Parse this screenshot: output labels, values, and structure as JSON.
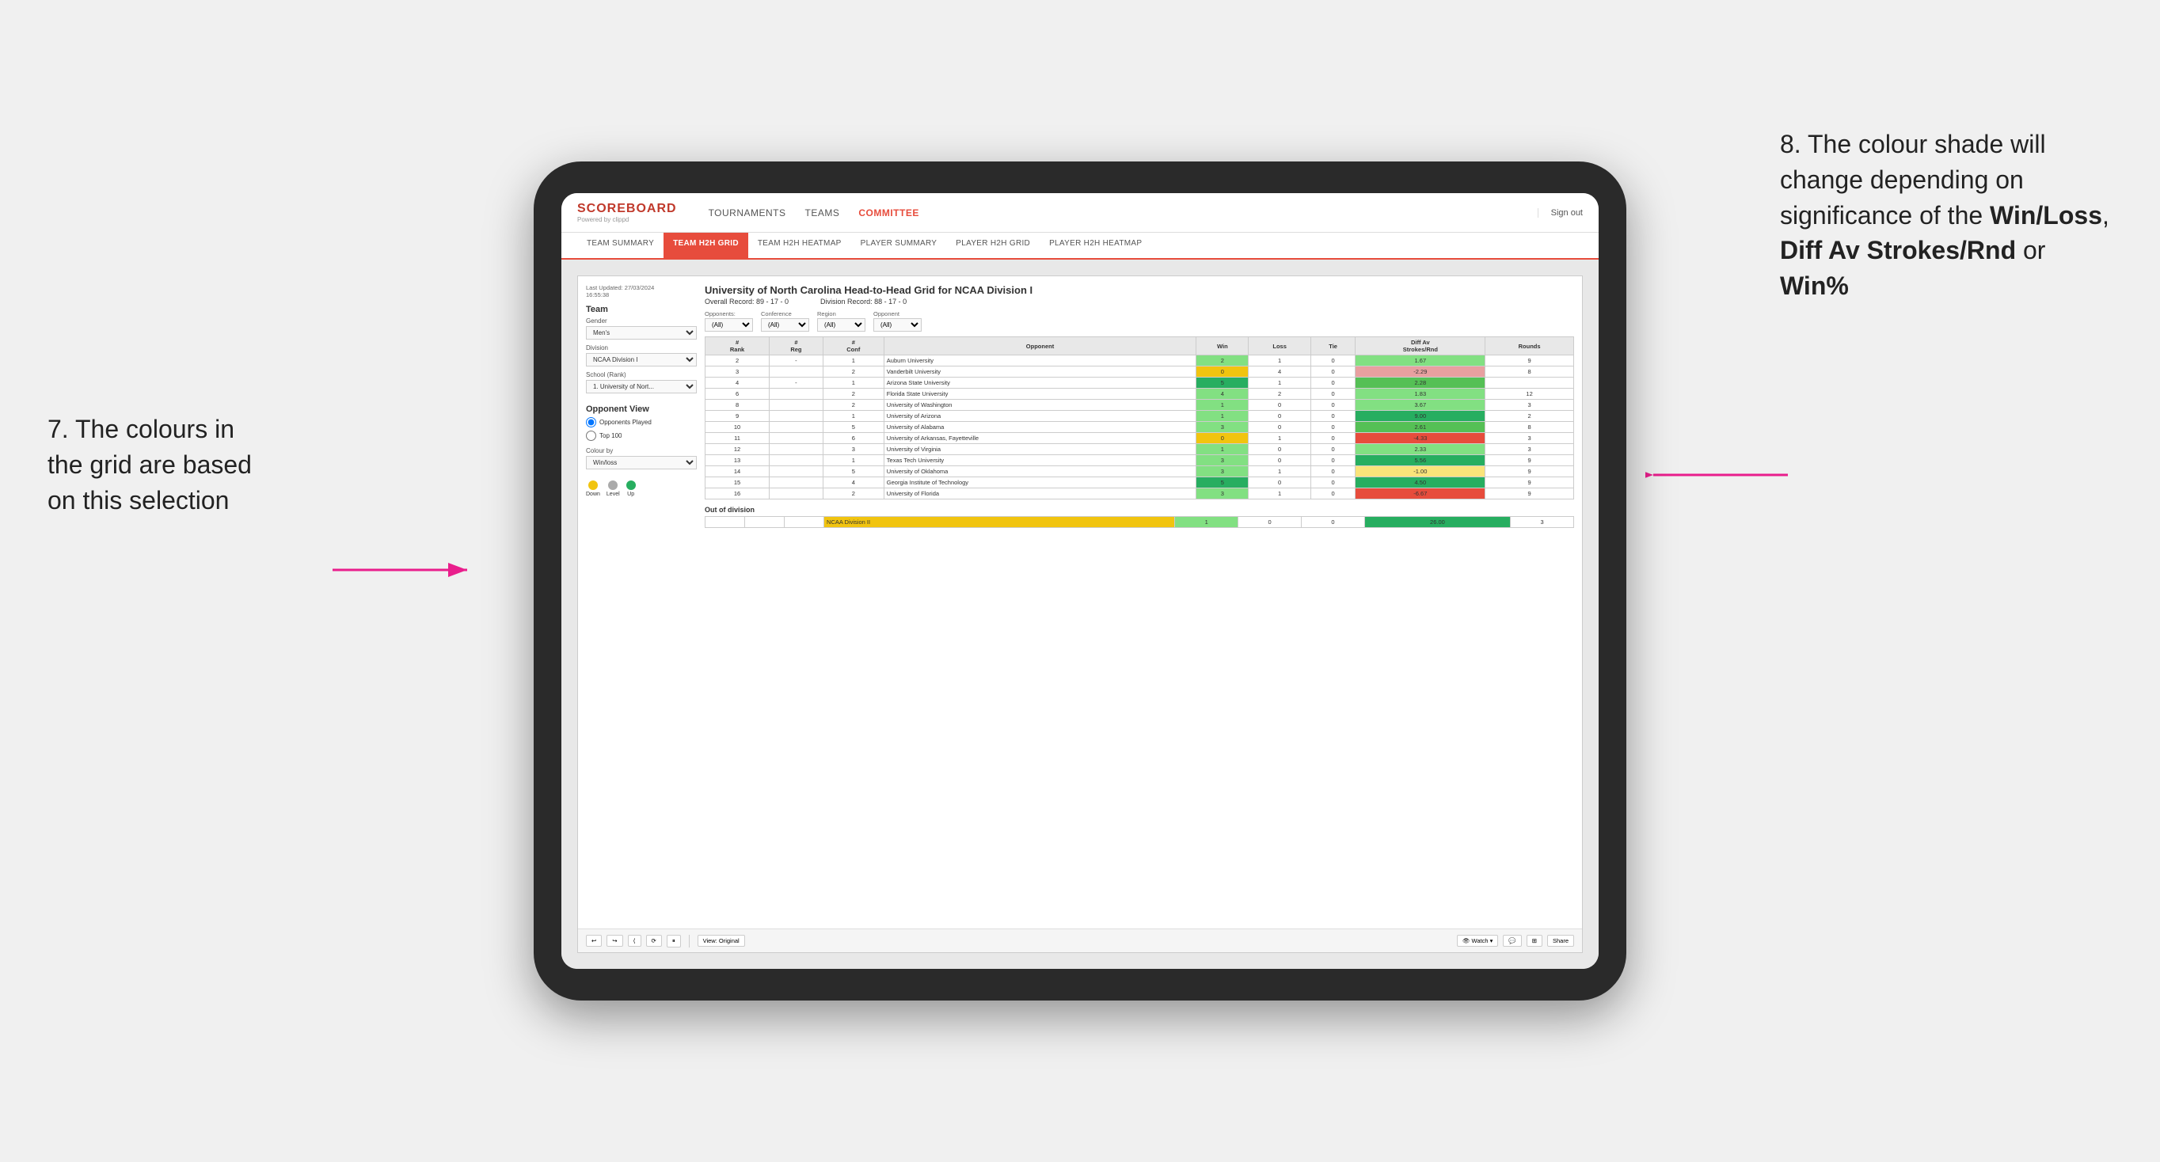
{
  "page": {
    "background": "#f0f0f0"
  },
  "annotation_left": {
    "text": "7. The colours in the grid are based on this selection"
  },
  "annotation_right": {
    "line1": "8. The colour shade will change depending on significance of the ",
    "bold1": "Win/Loss",
    "line2": ", ",
    "bold2": "Diff Av Strokes/Rnd",
    "line3": " or ",
    "bold3": "Win%"
  },
  "header": {
    "logo": "SCOREBOARD",
    "logo_sub": "Powered by clippd",
    "nav": [
      "TOURNAMENTS",
      "TEAMS",
      "COMMITTEE"
    ],
    "active_nav": "COMMITTEE",
    "sign_out": "Sign out"
  },
  "sub_nav": {
    "items": [
      "TEAM SUMMARY",
      "TEAM H2H GRID",
      "TEAM H2H HEATMAP",
      "PLAYER SUMMARY",
      "PLAYER H2H GRID",
      "PLAYER H2H HEATMAP"
    ],
    "active": "TEAM H2H GRID"
  },
  "left_panel": {
    "timestamp_label": "Last Updated: 27/03/2024",
    "timestamp_time": "16:55:38",
    "team_label": "Team",
    "gender_label": "Gender",
    "gender_value": "Men's",
    "division_label": "Division",
    "division_value": "NCAA Division I",
    "school_label": "School (Rank)",
    "school_value": "1. University of Nort...",
    "opponent_view_label": "Opponent View",
    "opponents_played": "Opponents Played",
    "top_100": "Top 100",
    "colour_by_label": "Colour by",
    "colour_by_value": "Win/loss",
    "legend": {
      "down_label": "Down",
      "level_label": "Level",
      "up_label": "Up",
      "down_color": "#f1c40f",
      "level_color": "#aaaaaa",
      "up_color": "#27ae60"
    }
  },
  "grid": {
    "title": "University of North Carolina Head-to-Head Grid for NCAA Division I",
    "overall_record": "Overall Record: 89 - 17 - 0",
    "division_record": "Division Record: 88 - 17 - 0",
    "filters": {
      "opponents_label": "Opponents:",
      "opponents_value": "(All)",
      "conference_label": "Conference",
      "conference_value": "(All)",
      "region_label": "Region",
      "region_value": "(All)",
      "opponent_label": "Opponent",
      "opponent_value": "(All)"
    },
    "columns": [
      "#\nRank",
      "#\nReg",
      "#\nConf",
      "Opponent",
      "Win",
      "Loss",
      "Tie",
      "Diff Av\nStrokes/Rnd",
      "Rounds"
    ],
    "rows": [
      {
        "rank": "2",
        "reg": "-",
        "conf": "1",
        "opponent": "Auburn University",
        "win": "2",
        "loss": "1",
        "tie": "0",
        "diff": "1.67",
        "rounds": "9",
        "win_color": "green-light",
        "diff_color": "green-light"
      },
      {
        "rank": "3",
        "reg": "",
        "conf": "2",
        "opponent": "Vanderbilt University",
        "win": "0",
        "loss": "4",
        "tie": "0",
        "diff": "-2.29",
        "rounds": "8",
        "win_color": "yellow",
        "diff_color": "red-light"
      },
      {
        "rank": "4",
        "reg": "-",
        "conf": "1",
        "opponent": "Arizona State University",
        "win": "5",
        "loss": "1",
        "tie": "0",
        "diff": "2.28",
        "rounds": "",
        "win_color": "green-dark",
        "diff_color": "green-mid"
      },
      {
        "rank": "6",
        "reg": "",
        "conf": "2",
        "opponent": "Florida State University",
        "win": "4",
        "loss": "2",
        "tie": "0",
        "diff": "1.83",
        "rounds": "12",
        "win_color": "green-light",
        "diff_color": "green-light"
      },
      {
        "rank": "8",
        "reg": "",
        "conf": "2",
        "opponent": "University of Washington",
        "win": "1",
        "loss": "0",
        "tie": "0",
        "diff": "3.67",
        "rounds": "3",
        "win_color": "green-light",
        "diff_color": "green-light"
      },
      {
        "rank": "9",
        "reg": "",
        "conf": "1",
        "opponent": "University of Arizona",
        "win": "1",
        "loss": "0",
        "tie": "0",
        "diff": "9.00",
        "rounds": "2",
        "win_color": "green-light",
        "diff_color": "green-dark"
      },
      {
        "rank": "10",
        "reg": "",
        "conf": "5",
        "opponent": "University of Alabama",
        "win": "3",
        "loss": "0",
        "tie": "0",
        "diff": "2.61",
        "rounds": "8",
        "win_color": "green-light",
        "diff_color": "green-mid"
      },
      {
        "rank": "11",
        "reg": "",
        "conf": "6",
        "opponent": "University of Arkansas, Fayetteville",
        "win": "0",
        "loss": "1",
        "tie": "0",
        "diff": "-4.33",
        "rounds": "3",
        "win_color": "yellow",
        "diff_color": "red"
      },
      {
        "rank": "12",
        "reg": "",
        "conf": "3",
        "opponent": "University of Virginia",
        "win": "1",
        "loss": "0",
        "tie": "0",
        "diff": "2.33",
        "rounds": "3",
        "win_color": "green-light",
        "diff_color": "green-light"
      },
      {
        "rank": "13",
        "reg": "",
        "conf": "1",
        "opponent": "Texas Tech University",
        "win": "3",
        "loss": "0",
        "tie": "0",
        "diff": "5.56",
        "rounds": "9",
        "win_color": "green-light",
        "diff_color": "green-dark"
      },
      {
        "rank": "14",
        "reg": "",
        "conf": "5",
        "opponent": "University of Oklahoma",
        "win": "3",
        "loss": "1",
        "tie": "0",
        "diff": "-1.00",
        "rounds": "9",
        "win_color": "green-light",
        "diff_color": "yellow-light"
      },
      {
        "rank": "15",
        "reg": "",
        "conf": "4",
        "opponent": "Georgia Institute of Technology",
        "win": "5",
        "loss": "0",
        "tie": "0",
        "diff": "4.50",
        "rounds": "9",
        "win_color": "green-dark",
        "diff_color": "green-dark"
      },
      {
        "rank": "16",
        "reg": "",
        "conf": "2",
        "opponent": "University of Florida",
        "win": "3",
        "loss": "1",
        "tie": "0",
        "diff": "-6.67",
        "rounds": "9",
        "win_color": "green-light",
        "diff_color": "red"
      }
    ],
    "out_division_title": "Out of division",
    "out_division_row": {
      "label": "NCAA Division II",
      "win": "1",
      "loss": "0",
      "tie": "0",
      "diff": "26.00",
      "rounds": "3",
      "win_color": "green-light",
      "diff_color": "green-dark"
    }
  },
  "toolbar": {
    "view_original": "View: Original",
    "watch": "Watch ▾",
    "share": "Share"
  }
}
